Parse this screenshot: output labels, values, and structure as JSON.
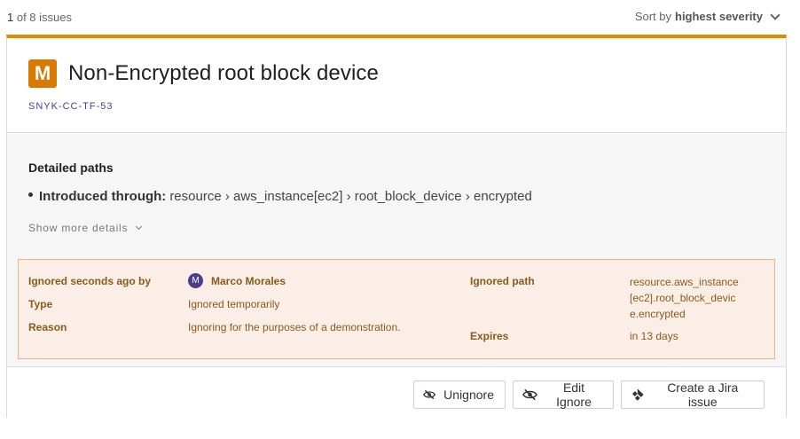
{
  "topbar": {
    "issue_index": "1",
    "issue_count_text": " of 8 issues",
    "sort_prefix": "Sort by",
    "sort_value": "highest severity"
  },
  "issue": {
    "severity_letter": "M",
    "severity_color": "#d97a00",
    "title": "Non-Encrypted root block device",
    "id": "SNYK-CC-TF-53"
  },
  "details": {
    "heading": "Detailed paths",
    "introduced_label": "Introduced through:",
    "introduced_path": "resource › aws_instance[ec2] › root_block_device › encrypted",
    "show_more": "Show more details"
  },
  "ignore": {
    "ignored_by_label": "Ignored seconds ago by",
    "user_initial": "M",
    "user_name": "Marco Morales",
    "type_label": "Type",
    "type_value": "Ignored temporarily",
    "reason_label": "Reason",
    "reason_value": "Ignoring for the purposes of a demonstration.",
    "path_label": "Ignored path",
    "path_value": "resource.aws_instance[ec2].root_block_device.encrypted",
    "expires_label": "Expires",
    "expires_value": "in 13 days"
  },
  "actions": {
    "unignore": "Unignore",
    "edit_ignore": "Edit Ignore",
    "create_jira": "Create a Jira issue"
  },
  "colors": {
    "accent_orange": "#e08a00",
    "ignore_bg": "#faeee6",
    "ignore_text": "#8a5a1a",
    "purple": "#4b3f8c"
  }
}
